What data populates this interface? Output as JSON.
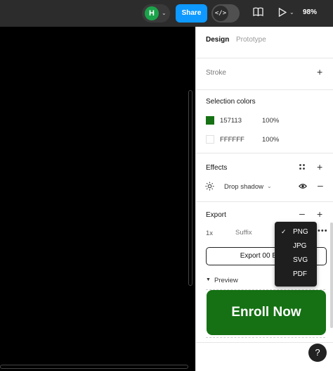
{
  "toolbar": {
    "avatar_initial": "H",
    "share_label": "Share",
    "code_toggle_glyph": "</>",
    "zoom": "98%",
    "icons": [
      "chevron-down-icon",
      "code-icon",
      "book-icon",
      "play-icon",
      "chevron-down-icon"
    ]
  },
  "panel": {
    "tabs": [
      {
        "label": "Design",
        "active": true
      },
      {
        "label": "Prototype",
        "active": false
      }
    ],
    "stroke": {
      "title": "Stroke"
    },
    "selection_colors": {
      "title": "Selection colors",
      "items": [
        {
          "hex": "157113",
          "opacity": "100%",
          "color": "#157113"
        },
        {
          "hex": "FFFFFF",
          "opacity": "100%",
          "color": "#FFFFFF"
        }
      ]
    },
    "effects": {
      "title": "Effects",
      "items": [
        {
          "name": "Drop shadow"
        }
      ]
    },
    "export": {
      "title": "Export",
      "scale": "1x",
      "suffix_placeholder": "Suffix",
      "button_label": "Export 00 Button",
      "preview_label": "Preview",
      "format_options": [
        {
          "label": "PNG",
          "selected": true
        },
        {
          "label": "JPG",
          "selected": false
        },
        {
          "label": "SVG",
          "selected": false
        },
        {
          "label": "PDF",
          "selected": false
        }
      ]
    },
    "preview_button_label": "Enroll Now",
    "preview_button_color": "#157113",
    "help_label": "?"
  },
  "colors": {
    "accent": "#0d99ff",
    "avatar": "#1ba34a"
  }
}
